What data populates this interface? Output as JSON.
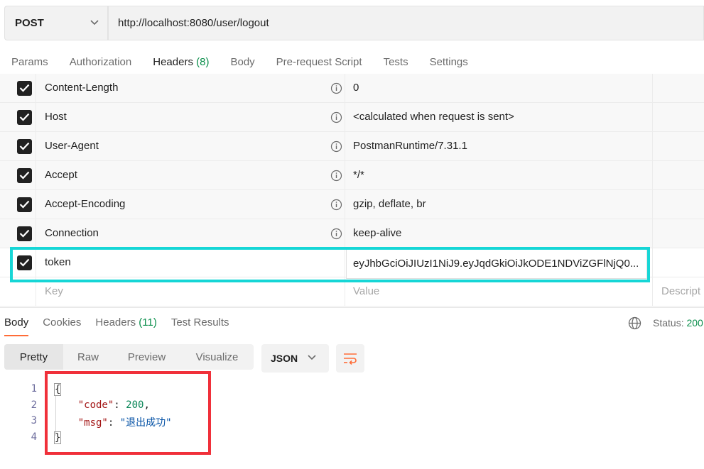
{
  "request": {
    "method": "POST",
    "url": "http://localhost:8080/user/logout"
  },
  "request_tabs": [
    {
      "label": "Params"
    },
    {
      "label": "Authorization"
    },
    {
      "label": "Headers",
      "count": "(8)"
    },
    {
      "label": "Body"
    },
    {
      "label": "Pre-request Script"
    },
    {
      "label": "Tests"
    },
    {
      "label": "Settings"
    }
  ],
  "headers": [
    {
      "key": "Content-Length",
      "value": "0"
    },
    {
      "key": "Host",
      "value": "<calculated when request is sent>"
    },
    {
      "key": "User-Agent",
      "value": "PostmanRuntime/7.31.1"
    },
    {
      "key": "Accept",
      "value": "*/*"
    },
    {
      "key": "Accept-Encoding",
      "value": "gzip, deflate, br"
    },
    {
      "key": "Connection",
      "value": "keep-alive"
    },
    {
      "key": "token",
      "value": "eyJhbGciOiJIUzI1NiJ9.eyJqdGkiOiJkODE1NDViZGFlNjQ0..."
    }
  ],
  "new_row": {
    "key_placeholder": "Key",
    "value_placeholder": "Value",
    "description_placeholder": "Descript"
  },
  "response_tabs": [
    {
      "label": "Body"
    },
    {
      "label": "Cookies"
    },
    {
      "label": "Headers",
      "count": "(11)"
    },
    {
      "label": "Test Results"
    }
  ],
  "status": {
    "label": "Status:",
    "value": "200"
  },
  "format_buttons": [
    {
      "label": "Pretty"
    },
    {
      "label": "Raw"
    },
    {
      "label": "Preview"
    },
    {
      "label": "Visualize"
    }
  ],
  "format_select": "JSON",
  "code": {
    "line_numbers": [
      "1",
      "2",
      "3",
      "4"
    ],
    "open_brace": "{",
    "close_brace": "}",
    "code_key": "\"code\"",
    "code_value": "200",
    "msg_key": "\"msg\"",
    "msg_value": "\"退出成功\""
  },
  "colors": {
    "accent": "#ff6c37",
    "highlight_cyan": "#16d6d6",
    "highlight_red": "#f0303a",
    "status_green": "#0a8e4b"
  },
  "icons": [
    "chevron-down-icon",
    "checkbox-checked-icon",
    "info-icon",
    "globe-icon",
    "wrap-lines-icon"
  ]
}
